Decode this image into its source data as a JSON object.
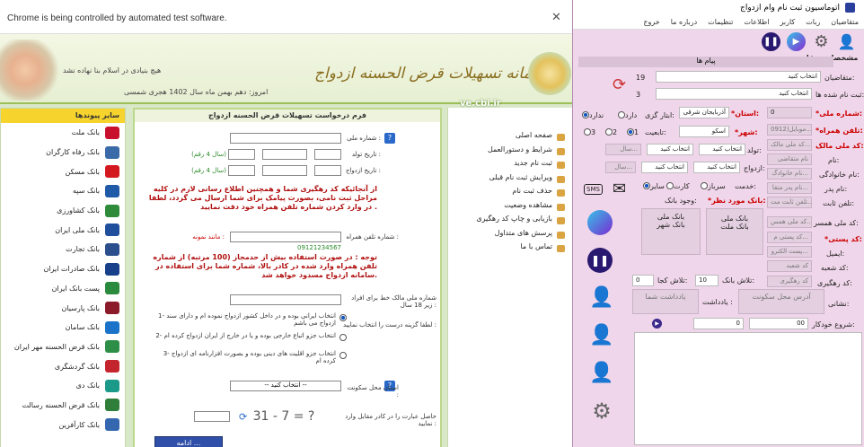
{
  "browser": {
    "automation_notice": "Chrome is being controlled by automated test software."
  },
  "site": {
    "tagline": "هیچ بنیادی در اسلام بنا نهاده نشد",
    "today": "امروز: دهم بهمن ماه سال 1402 هجری شمسی",
    "title": "سامانه تسهیلات قرض الحسنه ازدواج",
    "url_mark": "ve.cbi.ir",
    "left_nav": {
      "header": "سایر پیوندها",
      "items": [
        "بانک ملت",
        "بانک رفاه کارگران",
        "بانک مسکن",
        "بانک سپه",
        "بانک کشاورزی",
        "بانک ملی ایران",
        "بانک تجارت",
        "بانک صادرات ایران",
        "پست بانک ایران",
        "بانک پارسیان",
        "بانک سامان",
        "بانک قرض الحسنه مهر ایران",
        "بانک گردشگری",
        "بانک دی",
        "بانک قرض الحسنه رسالت",
        "بانک کارآفرین"
      ]
    },
    "right_menu": [
      "صفحه اصلی",
      "شرایط و دستورالعمل",
      "ثبت نام جدید",
      "ویرایش ثبت نام قبلی",
      "حذف ثبت نام",
      "مشاهده وضعیت",
      "بازیابی و چاپ کد رهگیری",
      "پرسش های متداول",
      "تماس با ما"
    ],
    "form": {
      "title": "فرم درخواست تسهیلات قرض الحسنه ازدواج",
      "national_code": "شماره ملی :",
      "birth_date": "تاریخ تولد :",
      "marriage_date": "تاریخ ازدواج :",
      "year_hint": "(سال 4 رقم)",
      "note1": "از آنجائیکه کد رهگیری شما و همچنین اطلاع رسانی لازم در کلیه مراحل ثبت نامی، بصورت پیامک برای شما ارسال می گردد، لطفا در وارد کردن شماره تلفن همراه خود دقت نمایید .",
      "mobile": "شماره تلفن همراه :",
      "mobile_sample_label": "مانند نمونه :",
      "mobile_sample": "09121234567",
      "note2": "توجه : در صورت استفاده بیش از حدمجاز (100 مرتبه) از شماره تلفن همراه وارد شده در کادر بالا، شماره شما برای استفاده در سامانه ازدواج مسدود خواهد شد.",
      "owner_label": "شماره ملی مالک خط برای افراد زیر 18 سال :",
      "choose_label": "لطفا گزینه درست را انتخاب نمایید :",
      "opt1": "1- انتخاب ایرانی بوده و در داخل کشور ازدواج نموده ام و دارای سند ازدواج می باشم",
      "opt2": "2- انتخاب جزو اتباع خارجی بوده و یا در خارج از ایران ازدواج کرده ام",
      "opt3": "3- انتخاب جزو اقلیت های دینی بوده و بصورت افزارنامه ای ازدواج کرده ام",
      "province_label": "استان محل سکونت :",
      "province_value": "-- انتخاب کنید --",
      "captcha_label": "حاصل عبارت را در کادر مقابل وارد نمایید :",
      "captcha_text": "31 - 7 = ?",
      "continue": "ادامه ..."
    }
  },
  "bot": {
    "title": "اتوماسیون ثبت نام وام ازدواج",
    "menu": [
      "متقاضیان",
      "ربات",
      "کاربر",
      "اطلاعات",
      "تنظیمات",
      "درباره ما",
      "خروج"
    ],
    "section": "مشخصات متقاضی",
    "messages_tab": "پیام ها",
    "applicants_label": "متقاضیان:",
    "applicants_value": "انتخاب کنید",
    "count1": "19",
    "registered_label": "ثبت نام شده ها:",
    "registered_value": "انتخاب کنید",
    "count2": "3",
    "national_code_label": "*شماره ملی:",
    "national_code_value": "0",
    "province_label": "*استان:",
    "province_value": "آذربایجان شرقی",
    "bank_label": "ابتار گزی:",
    "r_yes": "دارد",
    "r_no": "ندارد",
    "mobile_label": "*تلفن همراه:",
    "mobile_value": "موبایل(0912...",
    "city_label": "*شهر:",
    "city_value": "اسکو",
    "nationality_label": "تابعیت:",
    "r1": "1",
    "r2": "2",
    "r3": "3",
    "owner_label": "کد ملی مالک:",
    "owner_value": "کد ملی مالک...",
    "birth_label": "تولد:",
    "year_ph": "سال...",
    "select_ph": "انتخاب کنید",
    "name_label": "نام:",
    "name_value": "نام متقاضی",
    "family_label": "نام خانوادگی:",
    "family_value": "نام خانوادگ...",
    "marriage_label": "ازدواج:",
    "father_label": "نام پدر:",
    "father_value": "نام پدر متقا...",
    "service_label": "خدمت:",
    "r_soldier": "سرباز",
    "r_card": "کارت",
    "r_other": "سایر",
    "fixed_label": "تلفن ثابت:",
    "fixed_value": "تلفن ثابت مت...",
    "bank_pref_label": "*بانک مورد نظر:",
    "bank_exist_label": "وجود بانک:",
    "spouse_label": "کد ملی همسر:",
    "spouse_value": "کد ملی همس...",
    "bank1_a": "بانک ملی",
    "bank1_b": "بانک ملت",
    "bank2_a": "بانک ملی",
    "bank2_b": "بانک شهر",
    "postal_label": "*کد پستی:",
    "postal_value": "کد پستی م...",
    "email_label": "ایمیل:",
    "email_value": "پست الکترو...",
    "branch_label": "کد شعبه:",
    "branch_value": "کد شعبه",
    "tracking_label": "کد رهگیری:",
    "tracking_value": "کد رهگیری",
    "tries_label": "تلاش بانک:",
    "tries_value": "10",
    "where_label": "تلاش کجا:",
    "where_value": "0",
    "address_label": "نشانی:",
    "address_value": "آدرس محل سکونت",
    "note_label": "یادداشت :",
    "note_value": "یادداشت شما",
    "auto_label": "شروع خودکار:",
    "auto_hour": "00",
    "auto_min": "0",
    "sms": "SMS",
    "colors": {
      "accent": "#8b1a7a",
      "bg": "#f0d6ea",
      "field": "#e4cfe0"
    }
  }
}
